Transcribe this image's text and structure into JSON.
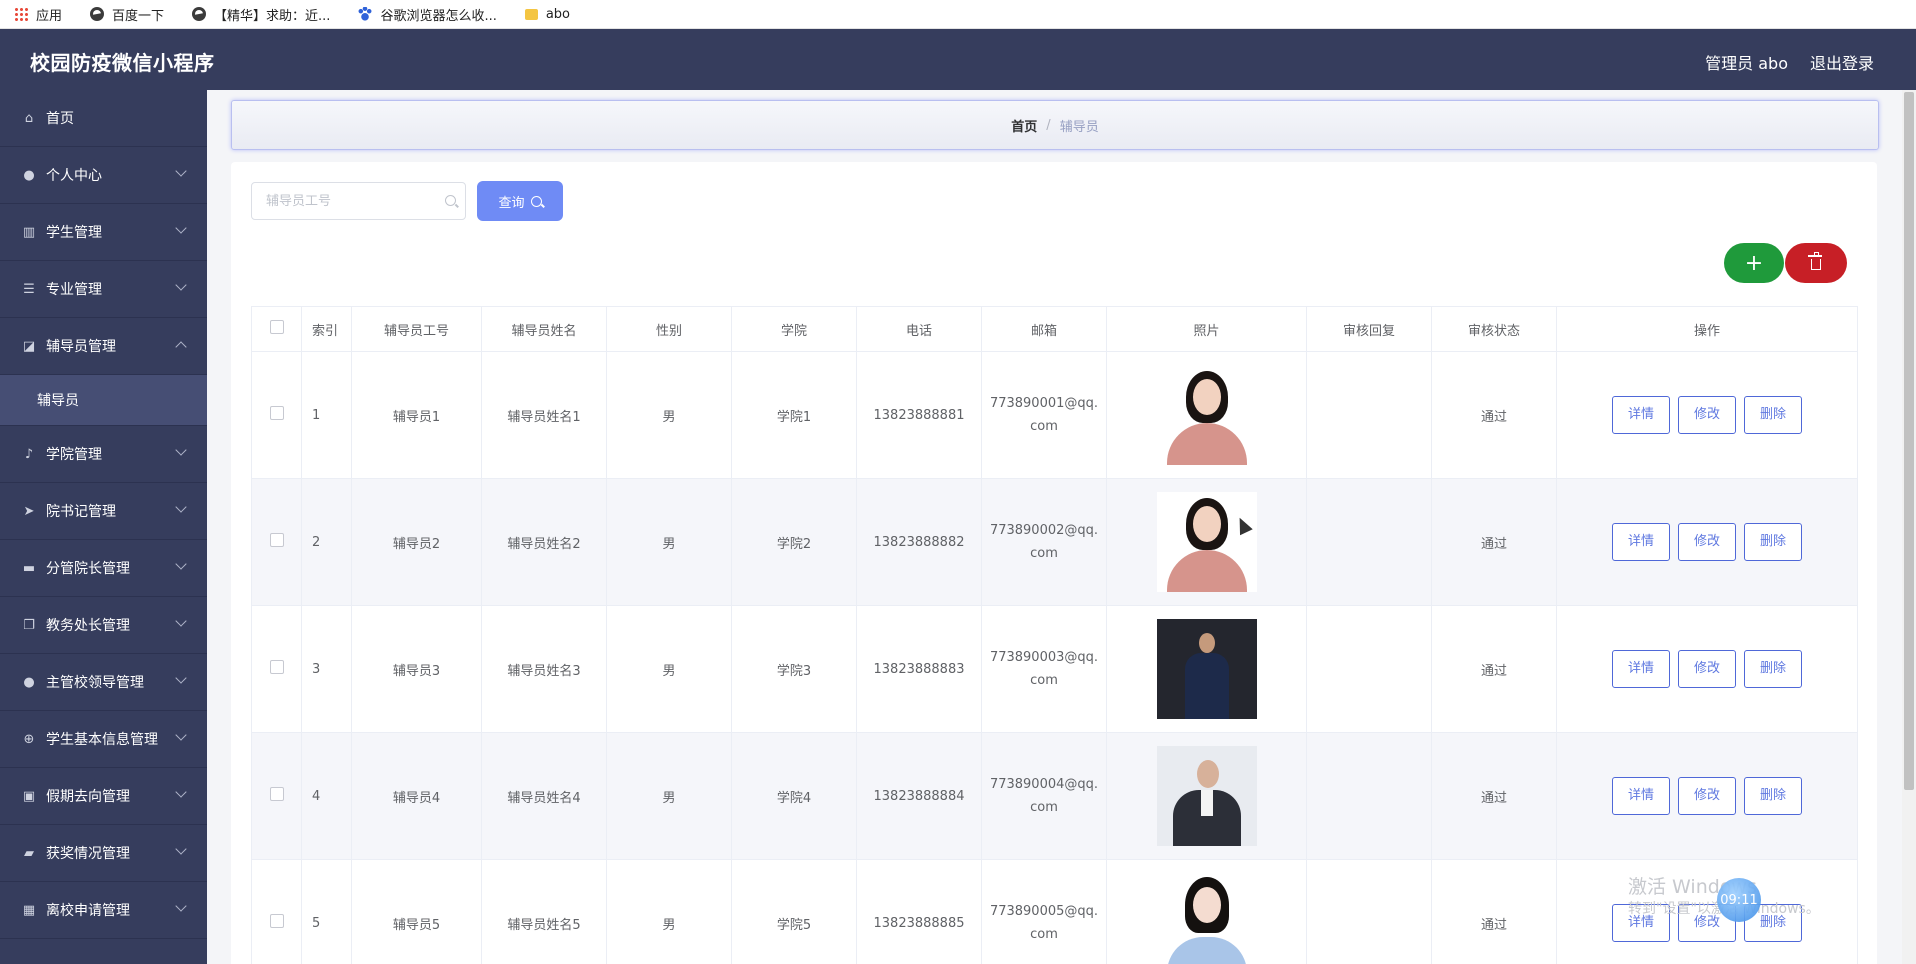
{
  "bookmarks": [
    {
      "label": "应用",
      "icon": "apps-grid-icon"
    },
    {
      "label": "百度一下",
      "icon": "globe-icon"
    },
    {
      "label": "【精华】求助：近...",
      "icon": "globe-icon"
    },
    {
      "label": "谷歌浏览器怎么收...",
      "icon": "baidu-paw-icon"
    },
    {
      "label": "abo",
      "icon": "folder-icon"
    }
  ],
  "header": {
    "title": "校园防疫微信小程序",
    "admin_label": "管理员 abo",
    "logout_label": "退出登录"
  },
  "sidebar": {
    "items": [
      {
        "label": "首页",
        "icon": "home-icon"
      },
      {
        "label": "个人中心",
        "icon": "user-icon"
      },
      {
        "label": "学生管理",
        "icon": "books-icon"
      },
      {
        "label": "专业管理",
        "icon": "list-icon"
      },
      {
        "label": "辅导员管理",
        "icon": "chart-icon",
        "expanded": true,
        "children": [
          {
            "label": "辅导员"
          }
        ]
      },
      {
        "label": "学院管理",
        "icon": "microphone-icon"
      },
      {
        "label": "院书记管理",
        "icon": "send-icon"
      },
      {
        "label": "分管院长管理",
        "icon": "monitor-icon"
      },
      {
        "label": "教务处长管理",
        "icon": "copy-icon"
      },
      {
        "label": "主管校领导管理",
        "icon": "user-icon"
      },
      {
        "label": "学生基本信息管理",
        "icon": "compass-icon"
      },
      {
        "label": "假期去向管理",
        "icon": "clipboard-icon"
      },
      {
        "label": "获奖情况管理",
        "icon": "brush-icon"
      },
      {
        "label": "离校申请管理",
        "icon": "grid-icon"
      }
    ]
  },
  "breadcrumb": {
    "home": "首页",
    "separator": "/",
    "current": "辅导员"
  },
  "search": {
    "placeholder": "辅导员工号",
    "value": "",
    "button_label": "查询"
  },
  "actions": {
    "add_icon": "plus-icon",
    "delete_icon": "trash-icon"
  },
  "table": {
    "columns": [
      "",
      "索引",
      "辅导员工号",
      "辅导员姓名",
      "性别",
      "学院",
      "电话",
      "邮箱",
      "照片",
      "审核回复",
      "审核状态",
      "操作"
    ],
    "rows": [
      {
        "index": "1",
        "id": "辅导员1",
        "name": "辅导员姓名1",
        "gender": "男",
        "college": "学院1",
        "phone": "13823888881",
        "email": "773890001@qq.com",
        "photo": "woman-pink-portrait",
        "reply": "",
        "status": "通过"
      },
      {
        "index": "2",
        "id": "辅导员2",
        "name": "辅导员姓名2",
        "gender": "男",
        "college": "学院2",
        "phone": "13823888882",
        "email": "773890002@qq.com",
        "photo": "woman-pink-portrait",
        "reply": "",
        "status": "通过"
      },
      {
        "index": "3",
        "id": "辅导员3",
        "name": "辅导员姓名3",
        "gender": "男",
        "college": "学院3",
        "phone": "13823888883",
        "email": "773890003@qq.com",
        "photo": "man-seated-dark-portrait",
        "reply": "",
        "status": "通过"
      },
      {
        "index": "4",
        "id": "辅导员4",
        "name": "辅导员姓名4",
        "gender": "男",
        "college": "学院4",
        "phone": "13823888884",
        "email": "773890004@qq.com",
        "photo": "man-suit-portrait",
        "reply": "",
        "status": "通过"
      },
      {
        "index": "5",
        "id": "辅导员5",
        "name": "辅导员姓名5",
        "gender": "男",
        "college": "学院5",
        "phone": "13823888885",
        "email": "773890005@qq.com",
        "photo": "girl-blue-portrait",
        "reply": "",
        "status": "通过"
      }
    ],
    "row_actions": {
      "detail": "详情",
      "edit": "修改",
      "delete": "删除"
    }
  },
  "overlay": {
    "watermark_title": "激活 Windows",
    "watermark_sub": "转到\"设置\"以激活 Windows。",
    "clock": "09:11"
  },
  "colors": {
    "sidebar_bg": "#363d5d",
    "accent": "#6f8bf5",
    "add": "#1f9a3b",
    "delete": "#c71f26",
    "action_border": "#4f68d8"
  }
}
